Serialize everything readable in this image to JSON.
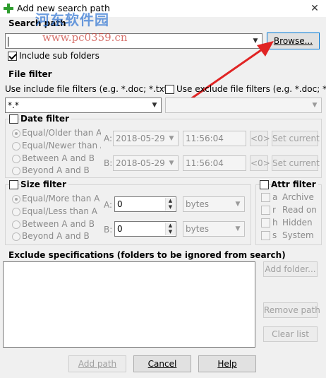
{
  "window": {
    "title": "Add new search path",
    "close": "✕"
  },
  "watermark": {
    "line1": "河东软件园",
    "line2": "www.pc0359.cn"
  },
  "search_path": {
    "label": "Search path",
    "value": "",
    "browse": "Browse...",
    "include_sub_folders": "Include sub folders",
    "include_checked": true
  },
  "file_filter": {
    "label": "File filter",
    "include_label": "Use include file filters (e.g. *.doc; *.txt)",
    "exclude_label": "Use exclude file filters (e.g. *.doc; *.tx",
    "include_value": "*.*",
    "exclude_value": ""
  },
  "date_filter": {
    "label": "Date filter",
    "options": [
      "Equal/Older than A",
      "Equal/Newer than A",
      "Between A and B",
      "Beyond A and B"
    ],
    "a_label": "A:",
    "b_label": "B:",
    "a_date": "2018-05-29",
    "a_time": "11:56:04",
    "b_date": "2018-05-29",
    "b_time": "11:56:04",
    "zero": "<0>",
    "set_current": "Set current"
  },
  "size_filter": {
    "label": "Size filter",
    "options": [
      "Equal/More than A",
      "Equal/Less than A",
      "Between A and B",
      "Beyond A and B"
    ],
    "a_label": "A:",
    "b_label": "B:",
    "a_value": "0",
    "b_value": "0",
    "unit": "bytes"
  },
  "attr_filter": {
    "label": "Attr filter",
    "items": [
      {
        "key": "a",
        "name": "Archive"
      },
      {
        "key": "r",
        "name": "Read on"
      },
      {
        "key": "h",
        "name": "Hidden"
      },
      {
        "key": "s",
        "name": "System"
      }
    ]
  },
  "exclude": {
    "label": "Exclude specifications (folders to be ignored from search)",
    "add_folder": "Add folder...",
    "remove_path": "Remove path",
    "clear_list": "Clear list"
  },
  "footer": {
    "add_path": "Add path",
    "cancel": "Cancel",
    "help": "Help"
  },
  "colors": {
    "arrow": "#e02424",
    "focus": "#0078d7"
  }
}
